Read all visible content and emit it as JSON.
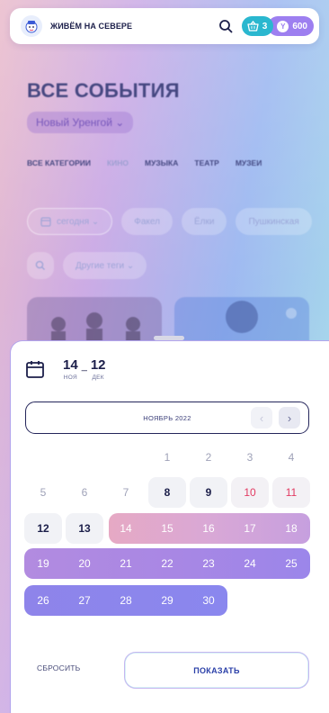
{
  "header": {
    "brand": "ЖИВЁМ НА СЕВЕРЕ",
    "cart_count": "3",
    "coins": "600",
    "coin_symbol": "Y"
  },
  "page": {
    "title": "ВСЕ СОБЫТИЯ",
    "city": "Новый Уренгой ⌄",
    "categories": [
      "ВСЕ КАТЕГОРИИ",
      "КИНО",
      "МУЗЫКА",
      "ТЕАТР",
      "МУЗЕИ"
    ],
    "date_filter": "сегодня ⌄",
    "tags": [
      "Факел",
      "Ёлки",
      "Пушкинская"
    ],
    "other_tags": "Другие теги ⌄"
  },
  "picker": {
    "start_day": "14",
    "start_month": "НОЯ",
    "end_day": "12",
    "end_month": "ДЕК",
    "separator": "_",
    "month_label": "НОЯБРЬ 2022",
    "prev": "‹",
    "next": "›",
    "reset_label": "СБРОСИТЬ",
    "show_label": "ПОКАЗАТЬ"
  },
  "calendar": {
    "row1": [
      "1",
      "2",
      "3",
      "4"
    ],
    "row2": [
      "5",
      "6",
      "7",
      "8",
      "9",
      "10",
      "11"
    ],
    "row3": [
      "12",
      "13",
      "14",
      "15",
      "16",
      "17",
      "18"
    ],
    "row4": [
      "19",
      "20",
      "21",
      "22",
      "23",
      "24",
      "25"
    ],
    "row5": [
      "26",
      "27",
      "28",
      "29",
      "30"
    ]
  },
  "colors": {
    "accent_teal": "#2ab7cf",
    "accent_purple": "#9d7ff0",
    "weekend_red": "#e23b62",
    "text_dark": "#1c1f4a"
  }
}
